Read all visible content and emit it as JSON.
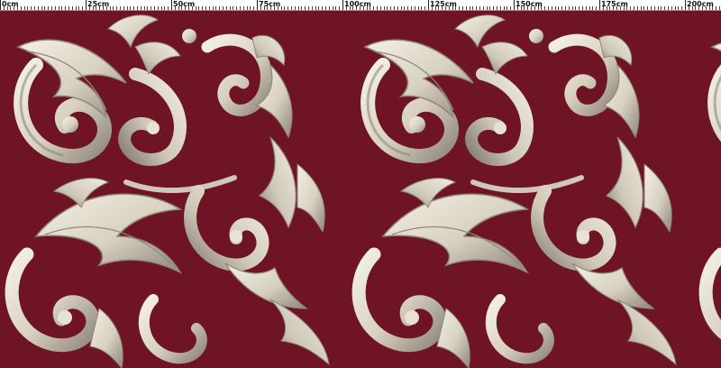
{
  "ruler": {
    "labels": [
      "0cm",
      "25cm",
      "50cm",
      "75cm",
      "100cm",
      "125cm",
      "150cm",
      "175cm",
      "200cm"
    ]
  },
  "fabric": {
    "background_color": "#6e1425",
    "ornament_color": "#ddd6c5",
    "shadow_color": "#8f887c",
    "highlight_color": "#f4f0e6",
    "motif": "baroque-acanthus-scroll"
  }
}
